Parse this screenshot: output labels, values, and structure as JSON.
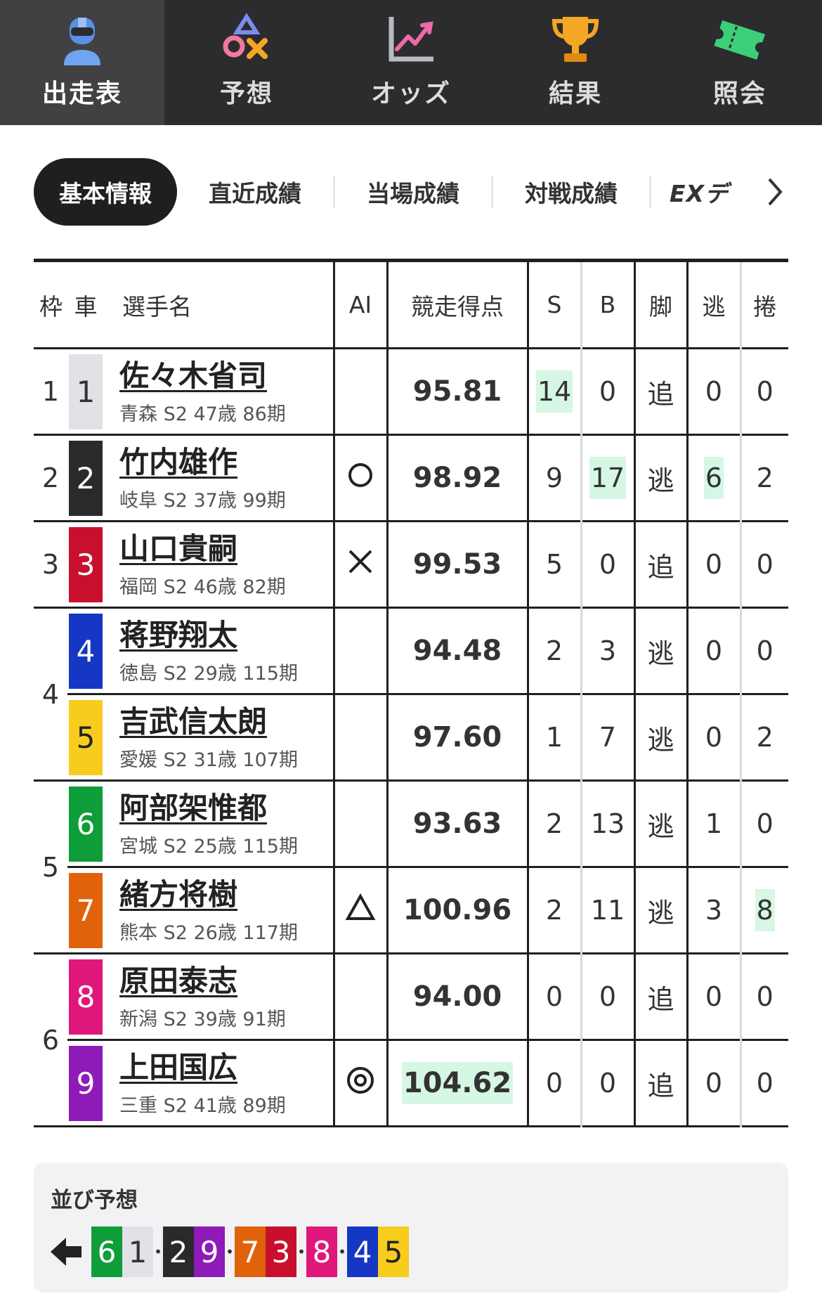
{
  "nav": {
    "items": [
      {
        "label": "出走表",
        "icon": "rider-icon"
      },
      {
        "label": "予想",
        "icon": "prediction-symbols-icon"
      },
      {
        "label": "オッズ",
        "icon": "chart-trend-icon"
      },
      {
        "label": "結果",
        "icon": "trophy-icon"
      },
      {
        "label": "照会",
        "icon": "ticket-icon"
      }
    ]
  },
  "tabs": {
    "items": [
      "基本情報",
      "直近成績",
      "当場成績",
      "対戦成績",
      "EXデ"
    ]
  },
  "table": {
    "headers": {
      "waku": "枠",
      "car": "車",
      "name": "選手名",
      "ai": "AI",
      "score": "競走得点",
      "s": "S",
      "b": "B",
      "style": "脚",
      "nige": "逃",
      "makuri": "捲"
    },
    "rows": [
      {
        "waku": "1",
        "car": "1",
        "name": "佐々木省司",
        "info": "青森 S2 47歳 86期",
        "ai": "",
        "score": "95.81",
        "s": "14",
        "b": "0",
        "style": "追",
        "nige": "0",
        "makuri": "0"
      },
      {
        "waku": "2",
        "car": "2",
        "name": "竹内雄作",
        "info": "岐阜 S2 37歳 99期",
        "ai": "○",
        "score": "98.92",
        "s": "9",
        "b": "17",
        "style": "逃",
        "nige": "6",
        "makuri": "2"
      },
      {
        "waku": "3",
        "car": "3",
        "name": "山口貴嗣",
        "info": "福岡 S2 46歳 82期",
        "ai": "✕",
        "score": "99.53",
        "s": "5",
        "b": "0",
        "style": "追",
        "nige": "0",
        "makuri": "0"
      },
      {
        "waku": "4",
        "car": "4",
        "name": "蒋野翔太",
        "info": "徳島 S2 29歳 115期",
        "ai": "",
        "score": "94.48",
        "s": "2",
        "b": "3",
        "style": "逃",
        "nige": "0",
        "makuri": "0"
      },
      {
        "waku": "",
        "car": "5",
        "name": "吉武信太朗",
        "info": "愛媛 S2 31歳 107期",
        "ai": "",
        "score": "97.60",
        "s": "1",
        "b": "7",
        "style": "逃",
        "nige": "0",
        "makuri": "2"
      },
      {
        "waku": "5",
        "car": "6",
        "name": "阿部架惟都",
        "info": "宮城 S2 25歳 115期",
        "ai": "",
        "score": "93.63",
        "s": "2",
        "b": "13",
        "style": "逃",
        "nige": "1",
        "makuri": "0"
      },
      {
        "waku": "",
        "car": "7",
        "name": "緒方将樹",
        "info": "熊本 S2 26歳 117期",
        "ai": "△",
        "score": "100.96",
        "s": "2",
        "b": "11",
        "style": "逃",
        "nige": "3",
        "makuri": "8"
      },
      {
        "waku": "6",
        "car": "8",
        "name": "原田泰志",
        "info": "新潟 S2 39歳 91期",
        "ai": "",
        "score": "94.00",
        "s": "0",
        "b": "0",
        "style": "追",
        "nige": "0",
        "makuri": "0"
      },
      {
        "waku": "",
        "car": "9",
        "name": "上田国広",
        "info": "三重 S2 41歳 89期",
        "ai": "◎",
        "score": "104.62",
        "s": "0",
        "b": "0",
        "style": "追",
        "nige": "0",
        "makuri": "0"
      }
    ]
  },
  "narabi": {
    "title": "並び予想",
    "groups": [
      [
        "6",
        "1"
      ],
      [
        "2",
        "9"
      ],
      [
        "7",
        "3"
      ],
      [
        "8"
      ],
      [
        "4",
        "5"
      ]
    ]
  },
  "colors": {
    "car1": "#e2e2e6",
    "car2": "#2a2a2c",
    "car3": "#c8102e",
    "car4": "#1537c4",
    "car5": "#f7cc1d",
    "car6": "#0f9d3a",
    "car7": "#e0630b",
    "car8": "#e0177a",
    "car9": "#8e1ab8",
    "highlight": "#d6f7e4"
  }
}
